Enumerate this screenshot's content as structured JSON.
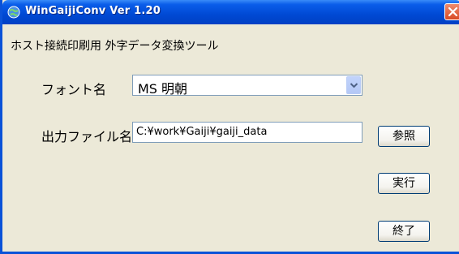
{
  "window": {
    "title": "WinGaijiConv Ver 1.20"
  },
  "heading": "ホスト接続印刷用 外字データ変換ツール",
  "font_field": {
    "label": "フォント名",
    "selected_value": "MS 明朝"
  },
  "output_field": {
    "label": "出力ファイル名",
    "value": "C:¥work¥Gaiji¥gaiji_data"
  },
  "buttons": {
    "browse": "参照",
    "execute": "実行",
    "exit": "終了"
  },
  "colors": {
    "titlebar": "#0049D4",
    "window_bg": "#ECE9D8",
    "close_button": "#D84A24"
  }
}
